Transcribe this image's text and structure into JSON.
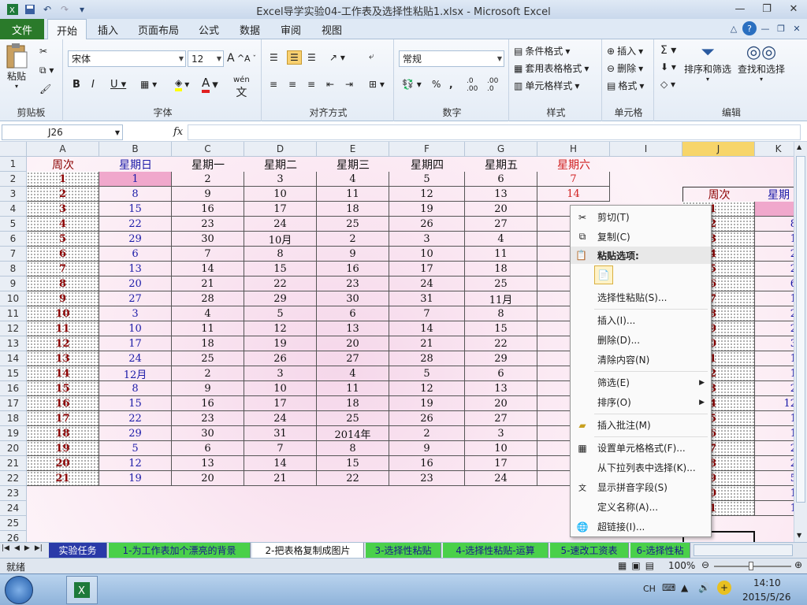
{
  "window": {
    "title": "Excel导学实验04-工作表及选择性粘贴1.xlsx - Microsoft Excel"
  },
  "tabs": {
    "file": "文件",
    "home": "开始",
    "insert": "插入",
    "layout": "页面布局",
    "formulas": "公式",
    "data": "数据",
    "review": "审阅",
    "view": "视图"
  },
  "ribbon": {
    "paste": "粘贴",
    "font_name": "宋体",
    "font_size": "12",
    "number_format": "常规",
    "cond_format": "条件格式",
    "table_format": "套用表格格式",
    "cell_style": "单元格样式",
    "insert": "插入",
    "delete": "删除",
    "format": "格式",
    "sort_filter": "排序和筛选",
    "find_select": "查找和选择",
    "wen": "wén",
    "groups": {
      "clipboard": "剪贴板",
      "font": "字体",
      "alignment": "对齐方式",
      "number": "数字",
      "styles": "样式",
      "cells": "单元格",
      "editing": "编辑"
    }
  },
  "formula_bar": {
    "name_box": "J26",
    "fx": "fx",
    "formula": ""
  },
  "columns": [
    "A",
    "B",
    "C",
    "D",
    "E",
    "F",
    "G",
    "H",
    "I",
    "J",
    "K"
  ],
  "rows": [
    "1",
    "2",
    "3",
    "4",
    "5",
    "6",
    "7",
    "8",
    "9",
    "10",
    "11",
    "12",
    "13",
    "14",
    "15",
    "16",
    "17",
    "18",
    "19",
    "20",
    "21",
    "22",
    "23",
    "24",
    "25",
    "26"
  ],
  "header_row": [
    "周次",
    "星期日",
    "星期一",
    "星期二",
    "星期三",
    "星期四",
    "星期五",
    "星期六"
  ],
  "week_numbers": [
    "1",
    "2",
    "3",
    "4",
    "5",
    "6",
    "7",
    "8",
    "9",
    "10",
    "11",
    "12",
    "13",
    "14",
    "15",
    "16",
    "17",
    "18",
    "19",
    "20",
    "21"
  ],
  "grid": [
    [
      "1",
      "2",
      "3",
      "4",
      "5",
      "6",
      "7"
    ],
    [
      "8",
      "9",
      "10",
      "11",
      "12",
      "13",
      "14"
    ],
    [
      "15",
      "16",
      "17",
      "18",
      "19",
      "20",
      ""
    ],
    [
      "22",
      "23",
      "24",
      "25",
      "26",
      "27",
      ""
    ],
    [
      "29",
      "30",
      "10月",
      "2",
      "3",
      "4",
      ""
    ],
    [
      "6",
      "7",
      "8",
      "9",
      "10",
      "11",
      ""
    ],
    [
      "13",
      "14",
      "15",
      "16",
      "17",
      "18",
      ""
    ],
    [
      "20",
      "21",
      "22",
      "23",
      "24",
      "25",
      ""
    ],
    [
      "27",
      "28",
      "29",
      "30",
      "31",
      "11月",
      ""
    ],
    [
      "3",
      "4",
      "5",
      "6",
      "7",
      "8",
      ""
    ],
    [
      "10",
      "11",
      "12",
      "13",
      "14",
      "15",
      ""
    ],
    [
      "17",
      "18",
      "19",
      "20",
      "21",
      "22",
      ""
    ],
    [
      "24",
      "25",
      "26",
      "27",
      "28",
      "29",
      ""
    ],
    [
      "12月",
      "2",
      "3",
      "4",
      "5",
      "6",
      ""
    ],
    [
      "8",
      "9",
      "10",
      "11",
      "12",
      "13",
      ""
    ],
    [
      "15",
      "16",
      "17",
      "18",
      "19",
      "20",
      ""
    ],
    [
      "22",
      "23",
      "24",
      "25",
      "26",
      "27",
      ""
    ],
    [
      "29",
      "30",
      "31",
      "2014年",
      "2",
      "3",
      ""
    ],
    [
      "5",
      "6",
      "7",
      "8",
      "9",
      "10",
      ""
    ],
    [
      "12",
      "13",
      "14",
      "15",
      "16",
      "17",
      ""
    ],
    [
      "19",
      "20",
      "21",
      "22",
      "23",
      "24",
      ""
    ]
  ],
  "picture_copy": {
    "header": "周次",
    "header2": "星期",
    "weeks": [
      "1",
      "2",
      "3",
      "4",
      "5",
      "6",
      "7",
      "8",
      "9",
      "10",
      "11",
      "12",
      "13",
      "14",
      "15",
      "16",
      "17",
      "18",
      "19",
      "20",
      "21"
    ],
    "col_b": [
      "",
      "8",
      "1",
      "2",
      "2",
      "6",
      "1",
      "2",
      "2",
      "3",
      "1",
      "1",
      "2",
      "12",
      "1",
      "1",
      "2",
      "2",
      "5",
      "1",
      "1"
    ]
  },
  "context_menu": {
    "cut": "剪切(T)",
    "copy": "复制(C)",
    "paste_options": "粘贴选项:",
    "paste_special": "选择性粘贴(S)...",
    "insert": "插入(I)...",
    "delete": "删除(D)...",
    "clear": "清除内容(N)",
    "filter": "筛选(E)",
    "sort": "排序(O)",
    "insert_comment": "插入批注(M)",
    "format_cells": "设置单元格格式(F)...",
    "pick_list": "从下拉列表中选择(K)...",
    "phonetic": "显示拼音字段(S)",
    "define_name": "定义名称(A)...",
    "hyperlink": "超链接(I)..."
  },
  "sheet_tabs": [
    "实验任务",
    "1-为工作表加个漂亮的背景",
    "2-把表格复制成图片",
    "3-选择性粘贴",
    "4-选择性粘贴-运算",
    "5-速改工资表",
    "6-选择性粘"
  ],
  "status": {
    "mode": "就绪",
    "zoom": "100%"
  },
  "taskbar": {
    "lang": "CH",
    "time": "14:10",
    "date": "2015/5/26"
  },
  "colors": {
    "file_tab": "#2a7a2a",
    "sunday": "#1a1aa8",
    "saturday": "#d02020",
    "week": "#8b0000"
  }
}
